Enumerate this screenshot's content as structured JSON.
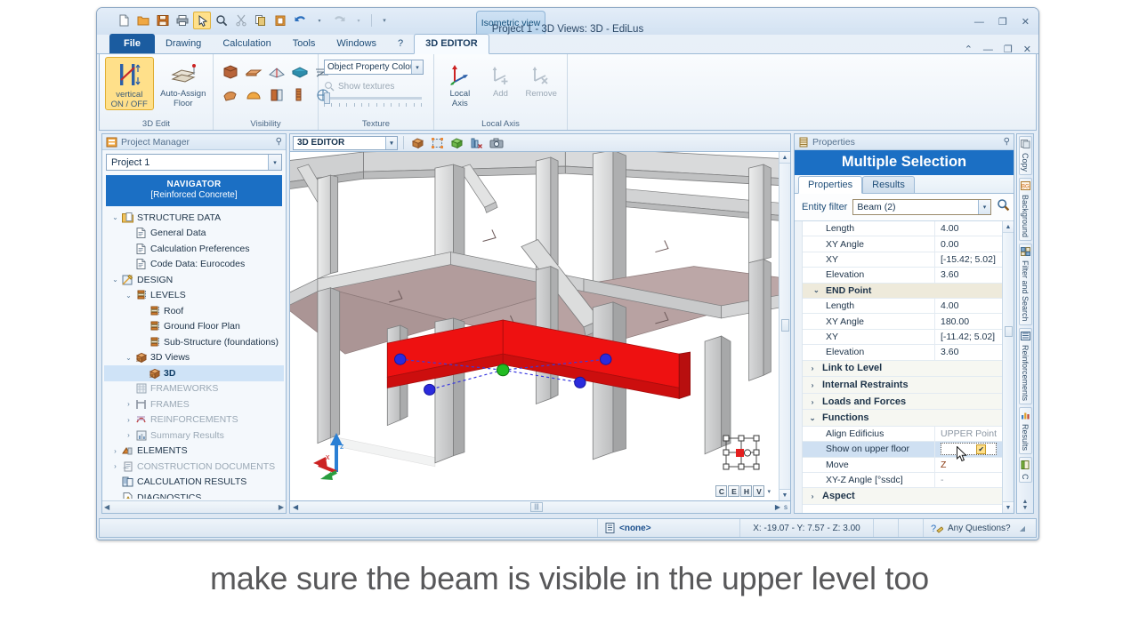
{
  "window": {
    "title": "Project 1 -  3D Views: 3D - EdiLus",
    "view_tab": "Isometric view",
    "minimize": "—",
    "restore": "❐",
    "close": "✕",
    "inner_restore_up": "⌃",
    "inner_minimize": "—",
    "inner_restore": "❐",
    "inner_close": "✕"
  },
  "quick_access": [
    {
      "name": "new-document-icon",
      "glyph": "📄"
    },
    {
      "name": "open-folder-icon",
      "glyph": "📂"
    },
    {
      "name": "save-icon",
      "glyph": "💾"
    },
    {
      "name": "print-icon",
      "glyph": "🖨"
    },
    {
      "name": "select-pointer-icon",
      "glyph": "↖",
      "selected": true
    },
    {
      "name": "zoom-icon",
      "glyph": "🔍"
    },
    {
      "name": "cut-scissors-icon",
      "glyph": "✂"
    },
    {
      "name": "copy-icon",
      "glyph": "⧉"
    },
    {
      "name": "paste-icon",
      "glyph": "📋"
    },
    {
      "name": "undo-icon",
      "glyph": "↶"
    },
    {
      "name": "redo-icon",
      "glyph": "↷"
    },
    {
      "name": "customize-qat-icon",
      "glyph": "▾"
    }
  ],
  "menu_tabs": [
    {
      "label": "File",
      "kind": "file"
    },
    {
      "label": "Drawing",
      "kind": "normal"
    },
    {
      "label": "Calculation",
      "kind": "normal"
    },
    {
      "label": "Tools",
      "kind": "normal"
    },
    {
      "label": "Windows",
      "kind": "normal"
    },
    {
      "label": "?",
      "kind": "normal"
    },
    {
      "label": "3D EDITOR",
      "kind": "active"
    }
  ],
  "ribbon": {
    "groups": [
      {
        "label": "3D Edit",
        "buttons": [
          {
            "label_line1": "vertical",
            "label_line2": "ON / OFF",
            "selected": true,
            "name": "vertical-on-off-button"
          },
          {
            "label_line1": "Auto-Assign",
            "label_line2": "Floor",
            "selected": false,
            "name": "auto-assign-floor-button"
          }
        ]
      },
      {
        "label": "Visibility",
        "icons": [
          "wall-visibility-icon",
          "beam-visibility-icon",
          "roof-visibility-icon",
          "slab-visibility-icon",
          "mesh-visibility-icon",
          "foundation-visibility-icon",
          "dome-visibility-icon",
          "column-visibility-icon",
          "pile-visibility-icon",
          "all-objects-visibility-icon"
        ]
      },
      {
        "label": "Texture",
        "combo_value": "Object Property Colou",
        "checkbox_label": "Show textures",
        "checkbox_checked": false
      },
      {
        "label": "Local Axis",
        "buttons": [
          {
            "label_line1": "Local",
            "label_line2": "Axis",
            "disabled": false,
            "name": "local-axis-button"
          },
          {
            "label_line1": "Add",
            "label_line2": "",
            "disabled": true,
            "name": "add-local-axis-button"
          },
          {
            "label_line1": "Remove",
            "label_line2": "",
            "disabled": true,
            "name": "remove-local-axis-button"
          }
        ]
      }
    ]
  },
  "project_manager": {
    "header": "Project Manager",
    "pin": "⚲",
    "project_combo": "Project 1",
    "navigator_line1": "NAVIGATOR",
    "navigator_line2": "[Reinforced Concrete]",
    "tree": [
      {
        "label": "STRUCTURE DATA",
        "indent": 0,
        "twisty": "v",
        "icon": "folder-icon",
        "dim": false
      },
      {
        "label": "General Data",
        "indent": 1,
        "twisty": "",
        "icon": "document-icon",
        "dim": false
      },
      {
        "label": "Calculation Preferences",
        "indent": 1,
        "twisty": "",
        "icon": "document-icon",
        "dim": false
      },
      {
        "label": "Code Data: Eurocodes",
        "indent": 1,
        "twisty": "",
        "icon": "document-icon",
        "dim": false
      },
      {
        "label": "DESIGN",
        "indent": 0,
        "twisty": "v",
        "icon": "design-icon",
        "dim": false
      },
      {
        "label": "LEVELS",
        "indent": 1,
        "twisty": "v",
        "icon": "levels-icon",
        "dim": false
      },
      {
        "label": "Roof",
        "indent": 2,
        "twisty": "",
        "icon": "level-icon",
        "dim": false
      },
      {
        "label": "Ground Floor Plan",
        "indent": 2,
        "twisty": "",
        "icon": "level-icon",
        "dim": false
      },
      {
        "label": "Sub-Structure (foundations)",
        "indent": 2,
        "twisty": "",
        "icon": "level-icon",
        "dim": false
      },
      {
        "label": "3D Views",
        "indent": 1,
        "twisty": "v",
        "icon": "cube-3d-icon",
        "dim": false
      },
      {
        "label": "3D",
        "indent": 2,
        "twisty": "",
        "icon": "cube-3d-icon",
        "dim": false,
        "selected": true
      },
      {
        "label": "FRAMEWORKS",
        "indent": 1,
        "twisty": "",
        "icon": "frameworks-icon",
        "dim": true
      },
      {
        "label": "FRAMES",
        "indent": 1,
        "twisty": ">",
        "icon": "frames-icon",
        "dim": true
      },
      {
        "label": "REINFORCEMENTS",
        "indent": 1,
        "twisty": ">",
        "icon": "reinforcements-icon",
        "dim": true
      },
      {
        "label": "Summary Results",
        "indent": 1,
        "twisty": ">",
        "icon": "summary-results-icon",
        "dim": true
      },
      {
        "label": "ELEMENTS",
        "indent": 0,
        "twisty": ">",
        "icon": "elements-icon",
        "dim": false
      },
      {
        "label": "CONSTRUCTION DOCUMENTS",
        "indent": 0,
        "twisty": ">",
        "icon": "construction-docs-icon",
        "dim": true
      },
      {
        "label": "CALCULATION RESULTS",
        "indent": 0,
        "twisty": "",
        "icon": "calculation-results-icon",
        "dim": false
      },
      {
        "label": "DIAGNOSTICS",
        "indent": 0,
        "twisty": "",
        "icon": "diagnostics-icon",
        "dim": false
      }
    ]
  },
  "editor_toolbar": {
    "combo_value": "3D EDITOR",
    "icons": [
      "solid-view-icon",
      "selection-box-icon",
      "render-view-icon",
      "hide-objects-icon",
      "camera-snapshot-icon"
    ]
  },
  "viewport": {
    "cehv_buttons": [
      "C",
      "E",
      "H",
      "V"
    ],
    "dropdown_glyph": "▾",
    "hscroll_left": "◀",
    "hscroll_right": "▶",
    "hscroll_corner": "s",
    "vscroll_up": "▲",
    "vscroll_down": "▼"
  },
  "properties": {
    "header": "Properties",
    "pin": "⚲",
    "title": "Multiple Selection",
    "tabs": [
      {
        "label": "Properties",
        "active": true
      },
      {
        "label": "Results",
        "active": false
      }
    ],
    "entity_filter_label": "Entity filter",
    "entity_filter_value": "Beam (2)",
    "search_icon": "🔍",
    "rows": [
      {
        "kind": "prop",
        "name": "Length",
        "value": "4.00"
      },
      {
        "kind": "prop",
        "name": "XY Angle",
        "value": "0.00"
      },
      {
        "kind": "prop",
        "name": "XY",
        "value": "[-15.42; 5.02]"
      },
      {
        "kind": "prop",
        "name": "Elevation",
        "value": "3.60"
      },
      {
        "kind": "section",
        "name": "END Point",
        "twisty": "v"
      },
      {
        "kind": "prop",
        "name": "Length",
        "value": "4.00"
      },
      {
        "kind": "prop",
        "name": "XY Angle",
        "value": "180.00"
      },
      {
        "kind": "prop",
        "name": "XY",
        "value": "[-11.42; 5.02]"
      },
      {
        "kind": "prop",
        "name": "Elevation",
        "value": "3.60"
      },
      {
        "kind": "cat",
        "name": "Link to Level",
        "twisty": ">"
      },
      {
        "kind": "cat",
        "name": "Internal Restraints",
        "twisty": ">"
      },
      {
        "kind": "cat",
        "name": "Loads and Forces",
        "twisty": ">"
      },
      {
        "kind": "cat",
        "name": "Functions",
        "twisty": "v"
      },
      {
        "kind": "prop",
        "name": "Align Edificius",
        "value": "UPPER Point",
        "muted": true
      },
      {
        "kind": "checkbox",
        "name": "Show on upper floor",
        "value": "✔",
        "highlight": true
      },
      {
        "kind": "prop",
        "name": "Move",
        "value": "Z",
        "accent": true
      },
      {
        "kind": "prop",
        "name": "XY-Z Angle  [°ssdc]",
        "value": "-",
        "muted": true
      },
      {
        "kind": "cat",
        "name": "Aspect",
        "twisty": ">"
      }
    ]
  },
  "side_tabs": [
    {
      "label": "Copy",
      "icon": "copy-icon"
    },
    {
      "label": "Background",
      "icon": "background-icon"
    },
    {
      "label": "Filter and Search",
      "icon": "filter-search-icon"
    },
    {
      "label": "Reinforcements",
      "icon": "reinforcements-icon"
    },
    {
      "label": "Results",
      "icon": "results-chart-icon"
    },
    {
      "label": "C",
      "icon": "clipboard-icon"
    }
  ],
  "status_bar": {
    "entity_icon": "entity-icon",
    "entity_value": "<none>",
    "coordinates": "X: -19.07 - Y: 7.57 - Z: 3.00",
    "help_icon": "help-icon",
    "help_label": "Any Questions?",
    "resize_grip": "◢"
  },
  "caption": {
    "text": "make sure the beam is visible in the upper level too"
  },
  "colors": {
    "accent_blue": "#1b6fc4",
    "file_tab_blue": "#1b5ca0",
    "selected_beam_red": "#ee1111",
    "highlight_yellow": "#ffe08a",
    "slab_mauve": "#bba3a3",
    "concrete_grey": "#c9cacb",
    "node_blue": "#2b2bdd",
    "node_green": "#22bb22"
  }
}
